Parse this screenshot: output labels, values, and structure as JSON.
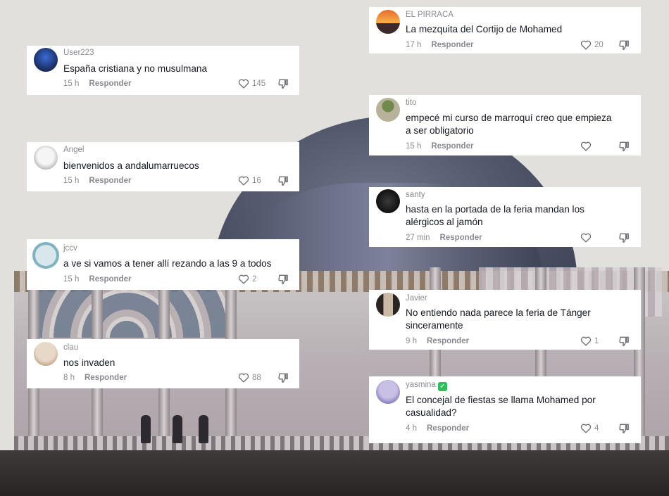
{
  "comments": [
    {
      "user": "EL PIRRACA",
      "text": "La mezquita del Cortijo de Mohamed",
      "time": "17 h",
      "reply": "Responder",
      "likes": "20",
      "avatar_colors": [
        "#e76b2e",
        "#f8b04a"
      ]
    },
    {
      "user": "User223",
      "text": "España cristiana y no musulmana",
      "time": "15 h",
      "reply": "Responder",
      "likes": "145",
      "avatar_colors": [
        "#1a2b5c",
        "#3a6bd6"
      ]
    },
    {
      "user": "tito",
      "text": "empecé mi curso de marroquí creo que empieza\na ser obligatorio",
      "time": "15 h",
      "reply": "Responder",
      "likes": "",
      "avatar_colors": [
        "#b8b29a",
        "#6f8a4a"
      ]
    },
    {
      "user": "Angel",
      "text": "bienvenidos a andalumarruecos",
      "time": "15 h",
      "reply": "Responder",
      "likes": "16",
      "avatar_colors": [
        "#d8d8d8",
        "#f5f5f5"
      ]
    },
    {
      "user": "santy",
      "text": "hasta en la portada de la feria mandan los\nalérgicos al jamón",
      "time": "27 min",
      "reply": "Responder",
      "likes": "",
      "avatar_colors": [
        "#111111",
        "#3a3a3a"
      ]
    },
    {
      "user": "jccv",
      "text": "a ve si vamos a tener allí rezando a las 9 a todos",
      "time": "15 h",
      "reply": "Responder",
      "likes": "2",
      "avatar_colors": [
        "#7fb3c2",
        "#d9e6ea"
      ]
    },
    {
      "user": "Javier",
      "text": "No entiendo nada parece la feria de Tánger\nsinceramente",
      "time": "9 h",
      "reply": "Responder",
      "likes": "1",
      "avatar_colors": [
        "#c9b9a5",
        "#2a2522"
      ]
    },
    {
      "user": "clau",
      "text": "nos invaden",
      "time": "8 h",
      "reply": "Responder",
      "likes": "88",
      "avatar_colors": [
        "#e8d8c8",
        "#c7a98e"
      ]
    },
    {
      "user": "yasmina",
      "verified_mark": "✓",
      "text": "El concejal de fiestas se llama Mohamed por\ncasualidad?",
      "time": "4 h",
      "reply": "Responder",
      "likes": "4",
      "avatar_colors": [
        "#c9c0e6",
        "#8a7fbf"
      ]
    }
  ],
  "colors": {
    "card_bg": "#ffffff",
    "meta": "#8a8b91",
    "text": "#161823",
    "badge": "#2ebd59"
  },
  "icons": {
    "like": "heart-outline-icon",
    "dislike": "thumbs-down-icon"
  }
}
